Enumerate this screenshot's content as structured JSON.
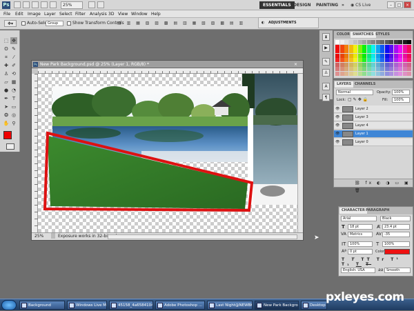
{
  "app": {
    "logo": "Ps",
    "zoom": "25%",
    "workspaces": [
      "ESSENTIALS",
      "DESIGN",
      "PAINTING"
    ],
    "cs_live": "CS Live"
  },
  "menus": [
    "File",
    "Edit",
    "Image",
    "Layer",
    "Select",
    "Filter",
    "Analysis",
    "3D",
    "View",
    "Window",
    "Help"
  ],
  "options": {
    "auto_select": "Auto-Select:",
    "group": "Group",
    "show_transform": "Show Transform Controls"
  },
  "adjustments": "ADJUSTMENTS",
  "document": {
    "title": "New Park Background.psd @ 25% (Layer 1, RGB/8) *",
    "zoom": "25%",
    "status": "Exposure works in 32-bit only"
  },
  "swatches_panel": {
    "tabs": [
      "COLOR",
      "SWATCHES",
      "STYLES"
    ]
  },
  "layers_panel": {
    "tabs": [
      "LAYERS",
      "CHANNELS"
    ],
    "blend": "Normal",
    "opacity_label": "Opacity:",
    "opacity": "100%",
    "lock_label": "Lock:",
    "fill_label": "Fill:",
    "fill": "100%",
    "layers": [
      {
        "name": "Layer 2",
        "selected": false
      },
      {
        "name": "Layer 3",
        "selected": false
      },
      {
        "name": "Layer 4",
        "selected": false
      },
      {
        "name": "Layer 1",
        "selected": true
      },
      {
        "name": "Layer 0",
        "selected": false
      }
    ]
  },
  "character_panel": {
    "tabs": [
      "CHARACTER",
      "PARAGRAPH"
    ],
    "font": "Arial",
    "style": "Black",
    "size": "18 pt",
    "leading": "23.4 pt",
    "kerning": "Metrics",
    "tracking": "-35",
    "vscale": "100%",
    "hscale": "100%",
    "baseline": "0 pt",
    "color_label": "Color:",
    "language": "English: USA",
    "aa": "Smooth",
    "aa_label": "aa",
    "color": "#ee1111"
  },
  "taskbar": [
    {
      "label": "Background",
      "active": false
    },
    {
      "label": "Windows Live Messe...",
      "active": false
    },
    {
      "label": "45158_4a6584104f...",
      "active": false
    },
    {
      "label": "Adobe Photoshop ...",
      "active": false
    },
    {
      "label": "Last Night@NEWBK...",
      "active": false
    },
    {
      "label": "New Park Backgro...",
      "active": true
    },
    {
      "label": "Desktop",
      "active": false
    }
  ],
  "watermark": "pxleyes.com",
  "colors": {
    "foreground": "#ee0000",
    "background": "#000000",
    "outline": "#dd1111"
  }
}
